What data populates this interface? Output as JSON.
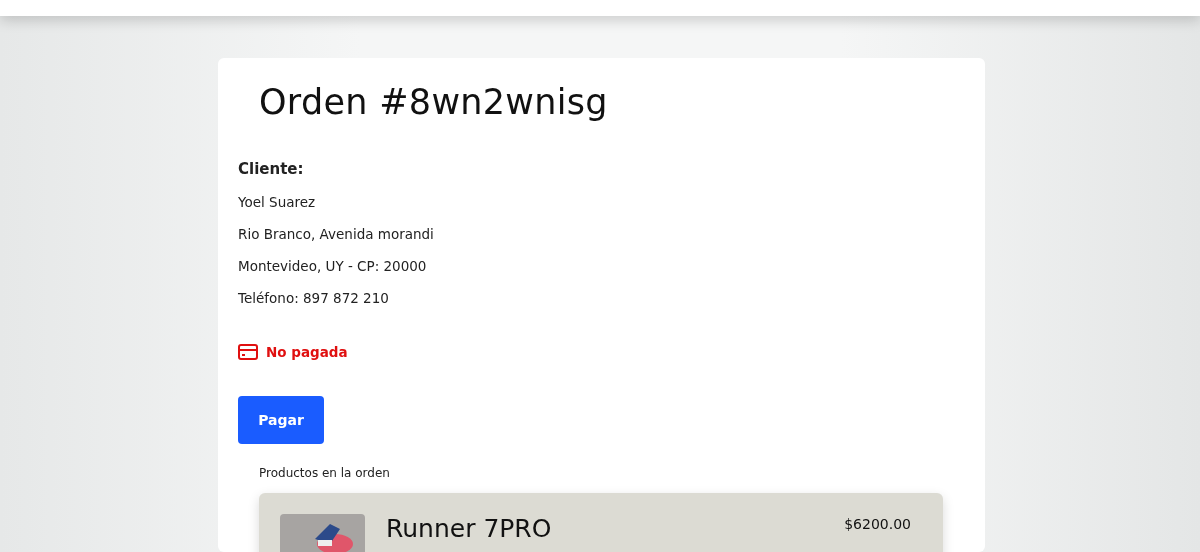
{
  "order": {
    "title": "Orden #8wn2wnisg"
  },
  "customer": {
    "heading": "Cliente:",
    "lines": [
      "Yoel Suarez",
      "Rio Branco, Avenida morandi",
      "Montevideo, UY - CP: 20000",
      "Teléfono: 897 872 210"
    ]
  },
  "payment": {
    "paid": false,
    "label": "No pagada"
  },
  "pay_button": "Pagar",
  "products_heading": "Productos en la orden",
  "products": [
    {
      "name": "Runner 7PRO",
      "price": "$6200.00"
    }
  ]
}
